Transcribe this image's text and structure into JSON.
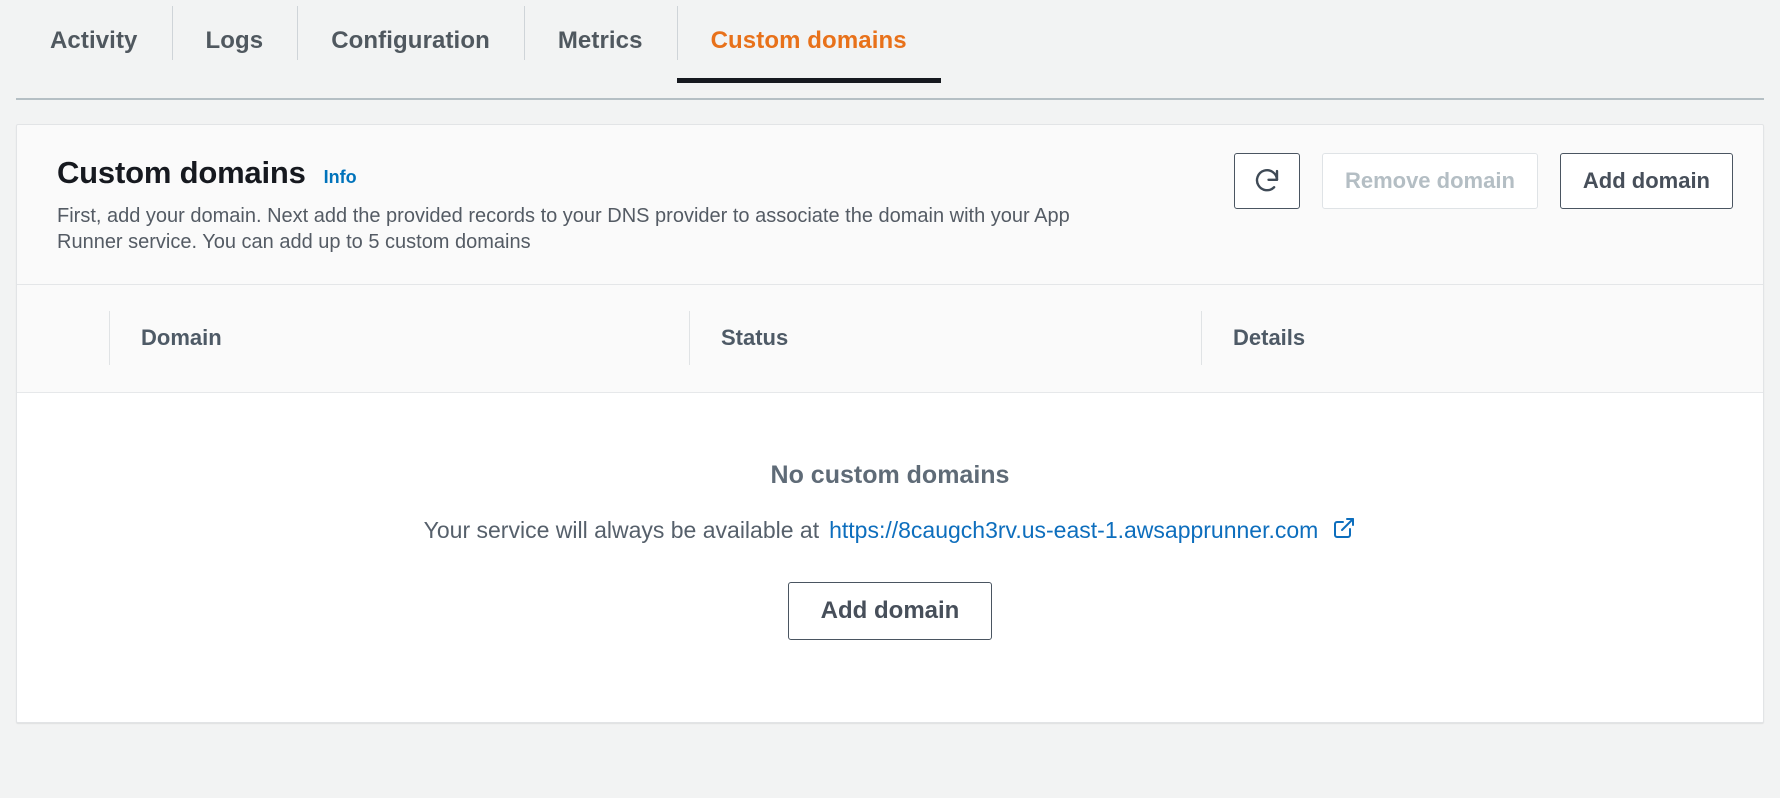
{
  "tabs": [
    {
      "label": "Activity",
      "active": false
    },
    {
      "label": "Logs",
      "active": false
    },
    {
      "label": "Configuration",
      "active": false
    },
    {
      "label": "Metrics",
      "active": false
    },
    {
      "label": "Custom domains",
      "active": true
    }
  ],
  "card": {
    "title": "Custom domains",
    "info_label": "Info",
    "description": "First, add your domain. Next add the provided records to your DNS provider to associate the domain with your App Runner service. You can add up to 5 custom domains",
    "actions": {
      "refresh_icon": "refresh-icon",
      "remove_label": "Remove domain",
      "remove_disabled": true,
      "add_label": "Add domain"
    }
  },
  "table": {
    "columns": [
      "Domain",
      "Status",
      "Details"
    ]
  },
  "empty_state": {
    "title": "No custom domains",
    "message_prefix": "Your service will always be available at",
    "url": "https://8caugch3rv.us-east-1.awsapprunner.com",
    "external_icon": "external-link-icon",
    "add_label": "Add domain"
  },
  "colors": {
    "accent_orange": "#e8711a",
    "link_blue": "#0073bb",
    "url_blue": "#0d6ebd",
    "text_dark": "#16191f",
    "text_muted": "#545b64",
    "page_bg": "#f2f3f3",
    "card_bg": "#fafafa"
  }
}
